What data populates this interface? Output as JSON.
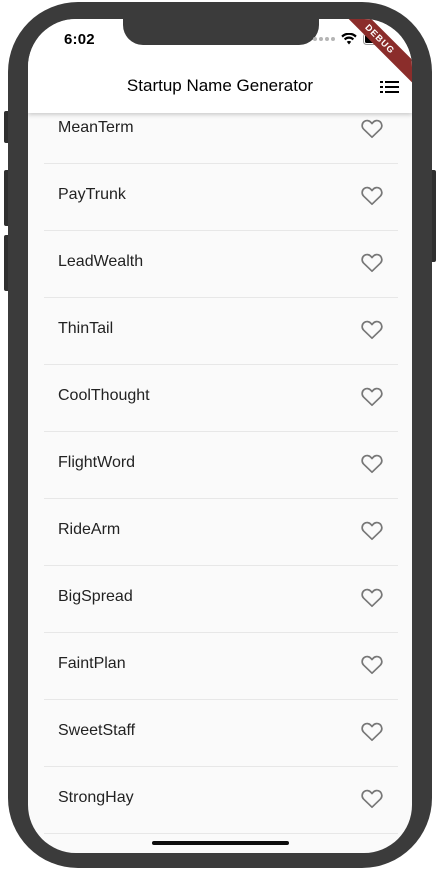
{
  "status_bar": {
    "time": "6:02"
  },
  "debug_banner": "DEBUG",
  "app_bar": {
    "title": "Startup Name Generator",
    "action_icon": "list-icon"
  },
  "list": {
    "items": [
      {
        "label": "MeanTerm",
        "icon": "heart-outline-icon"
      },
      {
        "label": "PayTrunk",
        "icon": "heart-outline-icon"
      },
      {
        "label": "LeadWealth",
        "icon": "heart-outline-icon"
      },
      {
        "label": "ThinTail",
        "icon": "heart-outline-icon"
      },
      {
        "label": "CoolThought",
        "icon": "heart-outline-icon"
      },
      {
        "label": "FlightWord",
        "icon": "heart-outline-icon"
      },
      {
        "label": "RideArm",
        "icon": "heart-outline-icon"
      },
      {
        "label": "BigSpread",
        "icon": "heart-outline-icon"
      },
      {
        "label": "FaintPlan",
        "icon": "heart-outline-icon"
      },
      {
        "label": "SweetStaff",
        "icon": "heart-outline-icon"
      },
      {
        "label": "StrongHay",
        "icon": "heart-outline-icon"
      },
      {
        "label": "",
        "icon": "heart-outline-icon"
      }
    ]
  },
  "colors": {
    "frame": "#3b3b3b",
    "screen_background": "#fafafa",
    "app_bar": "#ffffff",
    "icon": "#777777",
    "debug_banner": "#8b2d2b"
  }
}
